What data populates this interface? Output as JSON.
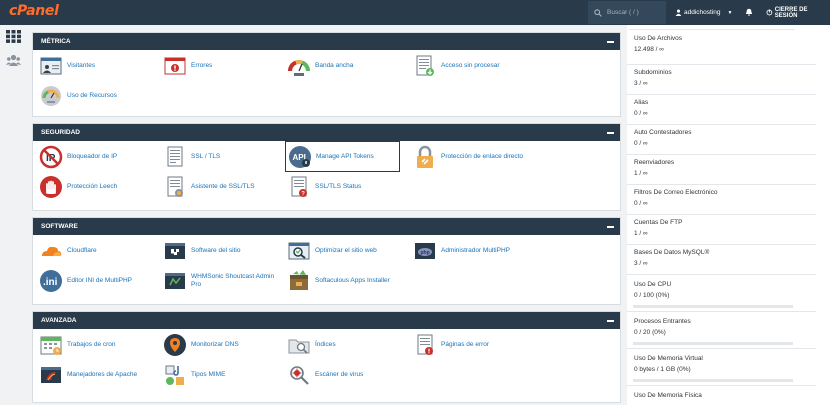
{
  "header": {
    "logo": "cPanel",
    "search_placeholder": "Buscar ( / )",
    "username": "addichosting",
    "logout": "CIERRE DE SESIÓN"
  },
  "colors": {
    "header": "#293a4a",
    "link": "#1a73b8",
    "logo": "#ff6c2c"
  },
  "sections": {
    "metrica": {
      "title": "MÉTRICA",
      "items": [
        "Visitantes",
        "Errores",
        "Banda ancha",
        "Acceso sin procesar",
        "Uso de Recursos"
      ]
    },
    "seguridad": {
      "title": "SEGURIDAD",
      "items": [
        "Bloqueador de IP",
        "SSL / TLS",
        "Manage API Tokens",
        "Protección de enlace directo",
        "Protección Leech",
        "Asistente de SSL/TLS",
        "SSL/TLS Status"
      ]
    },
    "software": {
      "title": "SOFTWARE",
      "items": [
        "Cloudflare",
        "Software del sitio",
        "Optimizar el sitio web",
        "Administrador MultiPHP",
        "Editor INI de MultiPHP",
        "WHMSonic Shoutcast Admin Pro",
        "Softaculous Apps Installer"
      ]
    },
    "avanzada": {
      "title": "AVANZADA",
      "items": [
        "Trabajos de cron",
        "Monitorizar DNS",
        "Índices",
        "Páginas de error",
        "Manejadores de Apache",
        "Tipos MIME",
        "Escáner de virus"
      ]
    }
  },
  "stats": [
    {
      "label": "Uso De Archivos",
      "value": "12.498 / ∞"
    },
    {
      "label": "Subdominios",
      "value": "3 / ∞"
    },
    {
      "label": "Alias",
      "value": "0 / ∞"
    },
    {
      "label": "Auto Contestadores",
      "value": "0 / ∞"
    },
    {
      "label": "Reenviadores",
      "value": "1 / ∞"
    },
    {
      "label": "Filtros De Correo Electrónico",
      "value": "0 / ∞"
    },
    {
      "label": "Cuentas De FTP",
      "value": "1 / ∞"
    },
    {
      "label": "Bases De Datos MySQL®",
      "value": "3 / ∞"
    },
    {
      "label": "Uso De CPU",
      "value": "0 / 100   (0%)",
      "fraction": 0.0
    },
    {
      "label": "Procesos Entrantes",
      "value": "0 / 20   (0%)",
      "fraction": 0.0
    },
    {
      "label": "Uso De Memoria Virtual",
      "value": "0 bytes / 1 GB   (0%)",
      "fraction": 0.0
    },
    {
      "label": "Uso De Memoria Física",
      "value": ""
    }
  ],
  "icons": {
    "rail": [
      "grid-icon",
      "users-icon"
    ],
    "metrica": [
      "visitors-icon",
      "errors-icon",
      "bandwidth-gauge-icon",
      "raw-access-icon",
      "resource-usage-icon"
    ],
    "seguridad": [
      "ip-blocker-icon",
      "ssl-tls-icon",
      "api-token-icon",
      "hotlink-lock-icon",
      "leech-hand-icon",
      "ssl-wizard-icon",
      "ssl-status-icon"
    ],
    "software": [
      "cloudflare-icon",
      "site-software-icon",
      "optimize-icon",
      "multiphp-icon",
      "ini-editor-icon",
      "shoutcast-icon",
      "softaculous-icon"
    ],
    "avanzada": [
      "cron-calendar-icon",
      "dns-monitor-icon",
      "indexes-icon",
      "error-pages-icon",
      "apache-handlers-icon",
      "mime-types-icon",
      "virus-scanner-icon"
    ]
  }
}
